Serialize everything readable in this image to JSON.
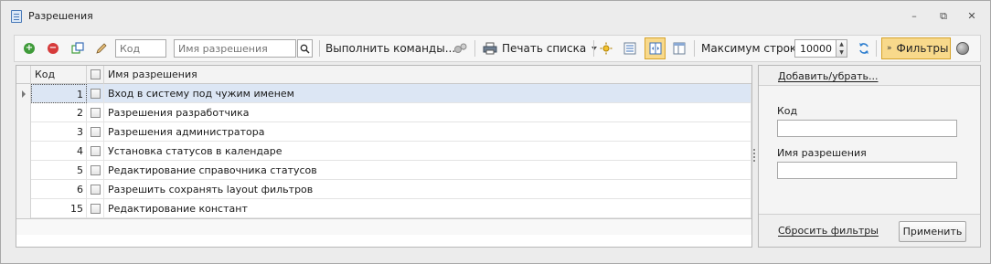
{
  "window": {
    "title": "Разрешения",
    "minimize": "–",
    "restore": "⧉",
    "close": "✕"
  },
  "toolbar": {
    "code_placeholder": "Код",
    "name_placeholder": "Имя разрешения",
    "execute_commands": "Выполнить команды...",
    "print_list": "Печать списка",
    "max_rows_label": "Максимум строк:",
    "max_rows_value": "10000",
    "filters_label": "Фильтры",
    "accent_color": "#f8d98b"
  },
  "grid": {
    "columns": [
      "Код",
      "Имя разрешения"
    ],
    "rows": [
      {
        "code": "1",
        "name": "Вход в систему под чужим именем"
      },
      {
        "code": "2",
        "name": "Разрешения разработчика"
      },
      {
        "code": "3",
        "name": "Разрешения администратора"
      },
      {
        "code": "4",
        "name": "Установка статусов в календаре"
      },
      {
        "code": "5",
        "name": "Редактирование справочника статусов"
      },
      {
        "code": "6",
        "name": "Разрешить сохранять layout фильтров"
      },
      {
        "code": "15",
        "name": "Редактирование констант"
      }
    ]
  },
  "filter_panel": {
    "add_remove": "Добавить/убрать...",
    "code_label": "Код",
    "name_label": "Имя разрешения",
    "reset_filters": "Сбросить фильтры",
    "apply": "Применить"
  }
}
